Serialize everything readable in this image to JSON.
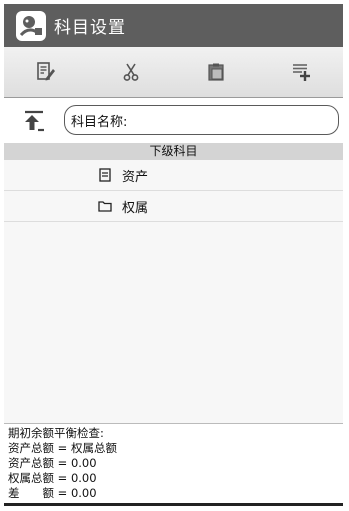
{
  "app": {
    "title": "科目设置",
    "icon": "app-logo-icon"
  },
  "toolbar": {
    "buttons": [
      {
        "icon": "edit-icon"
      },
      {
        "icon": "scissors-icon"
      },
      {
        "icon": "paste-icon"
      },
      {
        "icon": "add-item-icon"
      }
    ]
  },
  "search": {
    "up_icon": "level-up-icon",
    "label": "科目名称:",
    "value": ""
  },
  "list": {
    "header": "下级科目",
    "items": [
      {
        "label": "资产",
        "icon": "list-doc-icon"
      },
      {
        "label": "权属",
        "icon": "folder-icon"
      }
    ]
  },
  "summary": {
    "lines": [
      "期初余额平衡检查:",
      "资产总额 = 权属总额",
      "资产总额 = 0.00",
      "权属总额 = 0.00",
      "差　　额 = 0.00"
    ]
  },
  "colors": {
    "titlebar": "#5e5e5e",
    "header": "#d4d4d4",
    "list_bg": "#f7f7f7"
  }
}
